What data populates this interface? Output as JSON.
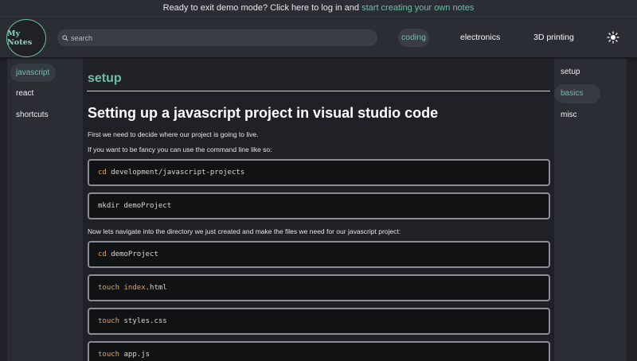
{
  "banner": {
    "text": "Ready to exit demo mode? Click here to log in and ",
    "link": "start creating your own notes"
  },
  "logo": {
    "text": "My Notes"
  },
  "search": {
    "placeholder": "search"
  },
  "nav": {
    "tabs": [
      {
        "label": "coding",
        "active": true
      },
      {
        "label": "electronics",
        "active": false
      },
      {
        "label": "3D printing",
        "active": false
      }
    ],
    "theme_icon": "sun-icon"
  },
  "left_sidebar": {
    "items": [
      {
        "label": "javascript",
        "active": true
      },
      {
        "label": "react",
        "active": false
      },
      {
        "label": "shortcuts",
        "active": false
      }
    ]
  },
  "right_sidebar": {
    "items": [
      {
        "label": "setup",
        "active": false
      },
      {
        "label": "basics",
        "active": true
      },
      {
        "label": "misc",
        "active": false
      }
    ]
  },
  "main": {
    "section_title": "setup",
    "heading": "Setting up a javascript project in visual studio code",
    "para1": "First we need to decide where our project is going to live.",
    "para2": "If you want to be fancy you can use the command line like so:",
    "para3": "Now lets navigate into the directory we just created and make the files we need for our javascript project:",
    "code_blocks": [
      {
        "cmd": "cd",
        "arg": " development/javascript-projects"
      },
      {
        "cmd": "",
        "arg": "mkdir demoProject"
      },
      {
        "cmd": "cd",
        "arg": " demoProject"
      },
      {
        "cmd": "touch",
        "arg1": "index",
        "arg2": ".html"
      },
      {
        "cmd": "touch",
        "arg": " styles.css"
      },
      {
        "cmd": "touch",
        "arg": " app.js"
      }
    ]
  },
  "colors": {
    "accent": "#6fbfa5",
    "background": "#1f2126",
    "panel": "#2a2d33",
    "code_keyword": "#e0a85b"
  }
}
